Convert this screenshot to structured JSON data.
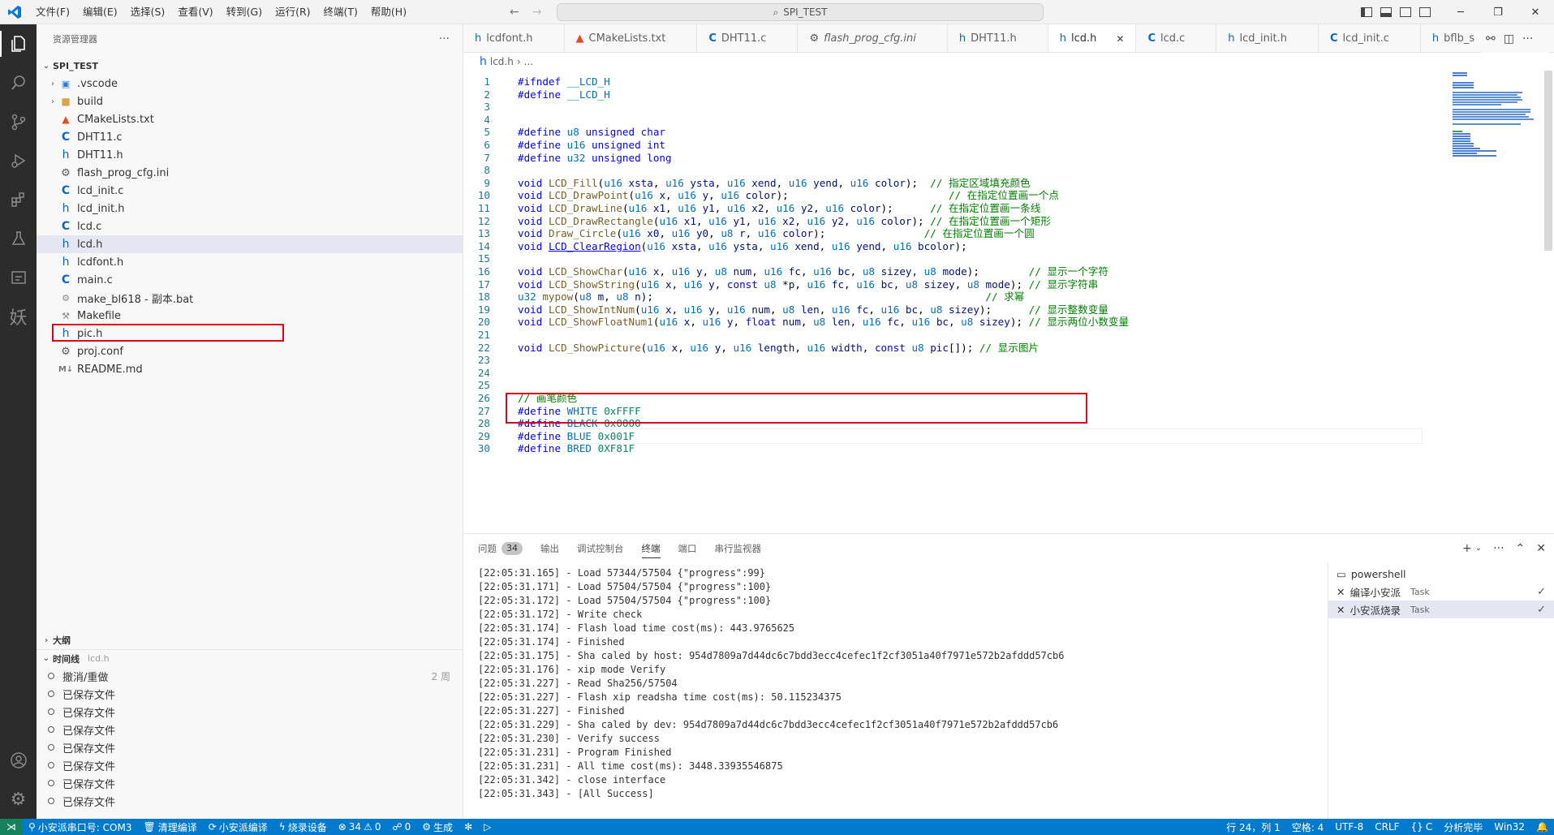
{
  "menu": [
    "文件(F)",
    "编辑(E)",
    "选择(S)",
    "查看(V)",
    "转到(G)",
    "运行(R)",
    "终端(T)",
    "帮助(H)"
  ],
  "search": {
    "text": "SPI_TEST"
  },
  "sidebar": {
    "header": "资源管理器",
    "more": "···",
    "project": "SPI_TEST",
    "items": [
      {
        "name": ".vscode",
        "icon": "folder-vscode-icon"
      },
      {
        "name": "build",
        "icon": "folder-icon"
      },
      {
        "name": "CMakeLists.txt",
        "icon": "cmake-icon"
      },
      {
        "name": "DHT11.c",
        "icon": "c-file-icon"
      },
      {
        "name": "DHT11.h",
        "icon": "h-file-icon"
      },
      {
        "name": "flash_prog_cfg.ini",
        "icon": "gear-icon"
      },
      {
        "name": "lcd_init.c",
        "icon": "c-file-icon"
      },
      {
        "name": "lcd_init.h",
        "icon": "h-file-icon"
      },
      {
        "name": "lcd.c",
        "icon": "c-file-icon"
      },
      {
        "name": "lcd.h",
        "icon": "h-file-icon"
      },
      {
        "name": "lcdfont.h",
        "icon": "h-file-icon"
      },
      {
        "name": "main.c",
        "icon": "c-file-icon"
      },
      {
        "name": "make_bl618 - 副本.bat",
        "icon": "bat-icon"
      },
      {
        "name": "Makefile",
        "icon": "makefile-icon"
      },
      {
        "name": "pic.h",
        "icon": "h-file-icon"
      },
      {
        "name": "proj.conf",
        "icon": "gear-icon"
      },
      {
        "name": "README.md",
        "icon": "markdown-icon"
      }
    ],
    "outline": "大纲",
    "timeline": "时间线",
    "timeline_file": "lcd.h",
    "timeline_items": [
      "撤消/重做",
      "已保存文件",
      "已保存文件",
      "已保存文件",
      "已保存文件",
      "已保存文件",
      "已保存文件",
      "已保存文件"
    ],
    "timeline_first_time": "2 周"
  },
  "tabs": [
    {
      "label": "lcdfont.h",
      "icon": "h"
    },
    {
      "label": "CMakeLists.txt",
      "icon": "cmake"
    },
    {
      "label": "DHT11.c",
      "icon": "c"
    },
    {
      "label": "flash_prog_cfg.ini",
      "icon": "gear"
    },
    {
      "label": "DHT11.h",
      "icon": "h"
    },
    {
      "label": "lcd.h",
      "icon": "h",
      "active": true
    },
    {
      "label": "lcd.c",
      "icon": "c"
    },
    {
      "label": "lcd_init.h",
      "icon": "h"
    },
    {
      "label": "lcd_init.c",
      "icon": "c"
    },
    {
      "label": "bflb_s",
      "icon": "h"
    }
  ],
  "breadcrumb": {
    "file": "lcd.h",
    "rest": "..."
  },
  "code": [
    {
      "n": "1",
      "html": "<span class='tk-pp'>#ifndef</span> <span class='tk-mac'>__LCD_H</span>"
    },
    {
      "n": "2",
      "html": "<span class='tk-pp'>#define</span> <span class='tk-mac'>__LCD_H</span>"
    },
    {
      "n": "3",
      "html": ""
    },
    {
      "n": "4",
      "html": ""
    },
    {
      "n": "5",
      "html": "<span class='tk-pp'>#define</span> <span class='tk-mac'>u8</span> <span class='tk-kw'>unsigned char</span>"
    },
    {
      "n": "6",
      "html": "<span class='tk-pp'>#define</span> <span class='tk-mac'>u16</span> <span class='tk-kw'>unsigned int</span>"
    },
    {
      "n": "7",
      "html": "<span class='tk-pp'>#define</span> <span class='tk-mac'>u32</span> <span class='tk-kw'>unsigned long</span>"
    },
    {
      "n": "8",
      "html": ""
    },
    {
      "n": "9",
      "html": "<span class='tk-kw'>void</span> <span class='tk-fn'>LCD_Fill</span>(<span class='tk-mac'>u16</span> <span class='tk-par'>xsta</span>, <span class='tk-mac'>u16</span> <span class='tk-par'>ysta</span>, <span class='tk-mac'>u16</span> <span class='tk-par'>xend</span>, <span class='tk-mac'>u16</span> <span class='tk-par'>yend</span>, <span class='tk-mac'>u16</span> <span class='tk-par'>color</span>);  <span class='tk-cm'>// 指定区域填充颜色</span>"
    },
    {
      "n": "10",
      "html": "<span class='tk-kw'>void</span> <span class='tk-fn'>LCD_DrawPoint</span>(<span class='tk-mac'>u16</span> <span class='tk-par'>x</span>, <span class='tk-mac'>u16</span> <span class='tk-par'>y</span>, <span class='tk-mac'>u16</span> <span class='tk-par'>color</span>);                          <span class='tk-cm'>// 在指定位置画一个点</span>"
    },
    {
      "n": "11",
      "html": "<span class='tk-kw'>void</span> <span class='tk-fn'>LCD_DrawLine</span>(<span class='tk-mac'>u16</span> <span class='tk-par'>x1</span>, <span class='tk-mac'>u16</span> <span class='tk-par'>y1</span>, <span class='tk-mac'>u16</span> <span class='tk-par'>x2</span>, <span class='tk-mac'>u16</span> <span class='tk-par'>y2</span>, <span class='tk-mac'>u16</span> <span class='tk-par'>color</span>);      <span class='tk-cm'>// 在指定位置画一条线</span>"
    },
    {
      "n": "12",
      "html": "<span class='tk-kw'>void</span> <span class='tk-fn'>LCD_DrawRectangle</span>(<span class='tk-mac'>u16</span> <span class='tk-par'>x1</span>, <span class='tk-mac'>u16</span> <span class='tk-par'>y1</span>, <span class='tk-mac'>u16</span> <span class='tk-par'>x2</span>, <span class='tk-mac'>u16</span> <span class='tk-par'>y2</span>, <span class='tk-mac'>u16</span> <span class='tk-par'>color</span>); <span class='tk-cm'>// 在指定位置画一个矩形</span>"
    },
    {
      "n": "13",
      "html": "<span class='tk-kw'>void</span> <span class='tk-fn'>Draw_Circle</span>(<span class='tk-mac'>u16</span> <span class='tk-par'>x0</span>, <span class='tk-mac'>u16</span> <span class='tk-par'>y0</span>, <span class='tk-mac'>u8</span> <span class='tk-par'>r</span>, <span class='tk-mac'>u16</span> <span class='tk-par'>color</span>);                <span class='tk-cm'>// 在指定位置画一个圆</span>"
    },
    {
      "n": "14",
      "html": "<span class='tk-kw'>void</span> <span class='tk-link'>LCD_ClearRegion</span>(<span class='tk-mac'>u16</span> <span class='tk-par'>xsta</span>, <span class='tk-mac'>u16</span> <span class='tk-par'>ysta</span>, <span class='tk-mac'>u16</span> <span class='tk-par'>xend</span>, <span class='tk-mac'>u16</span> <span class='tk-par'>yend</span>, <span class='tk-mac'>u16</span> <span class='tk-par'>bcolor</span>);"
    },
    {
      "n": "15",
      "html": ""
    },
    {
      "n": "16",
      "html": "<span class='tk-kw'>void</span> <span class='tk-fn'>LCD_ShowChar</span>(<span class='tk-mac'>u16</span> <span class='tk-par'>x</span>, <span class='tk-mac'>u16</span> <span class='tk-par'>y</span>, <span class='tk-mac'>u8</span> <span class='tk-par'>num</span>, <span class='tk-mac'>u16</span> <span class='tk-par'>fc</span>, <span class='tk-mac'>u16</span> <span class='tk-par'>bc</span>, <span class='tk-mac'>u8</span> <span class='tk-par'>sizey</span>, <span class='tk-mac'>u8</span> <span class='tk-par'>mode</span>);        <span class='tk-cm'>// 显示一个字符</span>"
    },
    {
      "n": "17",
      "html": "<span class='tk-kw'>void</span> <span class='tk-fn'>LCD_ShowString</span>(<span class='tk-mac'>u16</span> <span class='tk-par'>x</span>, <span class='tk-mac'>u16</span> <span class='tk-par'>y</span>, <span class='tk-kw'>const</span> <span class='tk-mac'>u8</span> *<span class='tk-par'>p</span>, <span class='tk-mac'>u16</span> <span class='tk-par'>fc</span>, <span class='tk-mac'>u16</span> <span class='tk-par'>bc</span>, <span class='tk-mac'>u8</span> <span class='tk-par'>sizey</span>, <span class='tk-mac'>u8</span> <span class='tk-par'>mode</span>); <span class='tk-cm'>// 显示字符串</span>"
    },
    {
      "n": "18",
      "html": "<span class='tk-mac'>u32</span> <span class='tk-fn'>mypow</span>(<span class='tk-mac'>u8</span> <span class='tk-par'>m</span>, <span class='tk-mac'>u8</span> <span class='tk-par'>n</span>);                                                      <span class='tk-cm'>// 求幂</span>"
    },
    {
      "n": "19",
      "html": "<span class='tk-kw'>void</span> <span class='tk-fn'>LCD_ShowIntNum</span>(<span class='tk-mac'>u16</span> <span class='tk-par'>x</span>, <span class='tk-mac'>u16</span> <span class='tk-par'>y</span>, <span class='tk-mac'>u16</span> <span class='tk-par'>num</span>, <span class='tk-mac'>u8</span> <span class='tk-par'>len</span>, <span class='tk-mac'>u16</span> <span class='tk-par'>fc</span>, <span class='tk-mac'>u16</span> <span class='tk-par'>bc</span>, <span class='tk-mac'>u8</span> <span class='tk-par'>sizey</span>);      <span class='tk-cm'>// 显示整数变量</span>"
    },
    {
      "n": "20",
      "html": "<span class='tk-kw'>void</span> <span class='tk-fn'>LCD_ShowFloatNum1</span>(<span class='tk-mac'>u16</span> <span class='tk-par'>x</span>, <span class='tk-mac'>u16</span> <span class='tk-par'>y</span>, <span class='tk-kw'>float</span> <span class='tk-par'>num</span>, <span class='tk-mac'>u8</span> <span class='tk-par'>len</span>, <span class='tk-mac'>u16</span> <span class='tk-par'>fc</span>, <span class='tk-mac'>u16</span> <span class='tk-par'>bc</span>, <span class='tk-mac'>u8</span> <span class='tk-par'>sizey</span>); <span class='tk-cm'>// 显示两位小数变量</span>"
    },
    {
      "n": "21",
      "html": ""
    },
    {
      "n": "22",
      "html": "<span class='tk-kw'>void</span> <span class='tk-fn'>LCD_ShowPicture</span>(<span class='tk-mac'>u16</span> <span class='tk-par'>x</span>, <span class='tk-mac'>u16</span> <span class='tk-par'>y</span>, <span class='tk-mac'>u16</span> <span class='tk-par'>length</span>, <span class='tk-mac'>u16</span> <span class='tk-par'>width</span>, <span class='tk-kw'>const</span> <span class='tk-mac'>u8</span> <span class='tk-par'>pic</span>[]); <span class='tk-cm'>// 显示图片</span>"
    },
    {
      "n": "23",
      "html": ""
    },
    {
      "n": "24",
      "html": ""
    },
    {
      "n": "25",
      "html": ""
    },
    {
      "n": "26",
      "html": "<span class='tk-cm'>// 画笔颜色</span>"
    },
    {
      "n": "27",
      "html": "<span class='tk-pp'>#define</span> <span class='tk-mac'>WHITE</span> <span class='tk-num'>0xFFFF</span>"
    },
    {
      "n": "28",
      "html": "<span class='tk-pp'>#define</span> <span class='tk-mac'>BLACK</span> <span class='tk-num'>0x0000</span>"
    },
    {
      "n": "29",
      "html": "<span class='tk-pp'>#define</span> <span class='tk-mac'>BLUE</span> <span class='tk-num'>0x001F</span>"
    },
    {
      "n": "30",
      "html": "<span class='tk-pp'>#define</span> <span class='tk-mac'>BRED</span> <span class='tk-num'>0XF81F</span>"
    }
  ],
  "panel": {
    "tabs": [
      {
        "label": "问题",
        "badge": "34"
      },
      {
        "label": "输出"
      },
      {
        "label": "调试控制台"
      },
      {
        "label": "终端",
        "active": true
      },
      {
        "label": "端口"
      },
      {
        "label": "串行监视器"
      }
    ],
    "terminal_lines": [
      "[22:05:31.165] - Load 57344/57504 {\"progress\":99}",
      "[22:05:31.171] - Load 57504/57504 {\"progress\":100}",
      "[22:05:31.172] - Load 57504/57504 {\"progress\":100}",
      "[22:05:31.172] - Write check",
      "[22:05:31.174] - Flash load time cost(ms): 443.9765625",
      "[22:05:31.174] - Finished",
      "[22:05:31.175] - Sha caled by host: 954d7809a7d44dc6c7bdd3ecc4cefec1f2cf3051a40f7971e572b2afddd57cb6",
      "[22:05:31.176] - xip mode Verify",
      "[22:05:31.227] - Read Sha256/57504",
      "[22:05:31.227] - Flash xip readsha time cost(ms): 50.115234375",
      "[22:05:31.227] - Finished",
      "[22:05:31.229] - Sha caled by dev: 954d7809a7d44dc6c7bdd3ecc4cefec1f2cf3051a40f7971e572b2afddd57cb6",
      "[22:05:31.230] - Verify success",
      "[22:05:31.231] - Program Finished",
      "[22:05:31.231] - All time cost(ms): 3448.33935546875",
      "[22:05:31.342] - close interface",
      "[22:05:31.343] - [All Success]"
    ],
    "terminals": [
      {
        "label": "powershell",
        "task": ""
      },
      {
        "label": "编译小安派",
        "task": "Task",
        "check": true
      },
      {
        "label": "小安派烧录",
        "task": "Task",
        "check": true,
        "selected": true
      }
    ]
  },
  "status": {
    "serial": "小安派串口号: COM3",
    "clean": "清理编译",
    "build": "小安派编译",
    "flash": "烧录设备",
    "errors": "34",
    "warnings": "0",
    "ports": "0",
    "generate": "生成",
    "position": "行 24，列 1",
    "spaces": "空格: 4",
    "encoding": "UTF-8",
    "eol": "CRLF",
    "lang": "C",
    "analysis": "分析完毕",
    "platform": "Win32"
  },
  "colors": {
    "statusbar": "#007acc",
    "highlight_box": "#e0001a"
  }
}
